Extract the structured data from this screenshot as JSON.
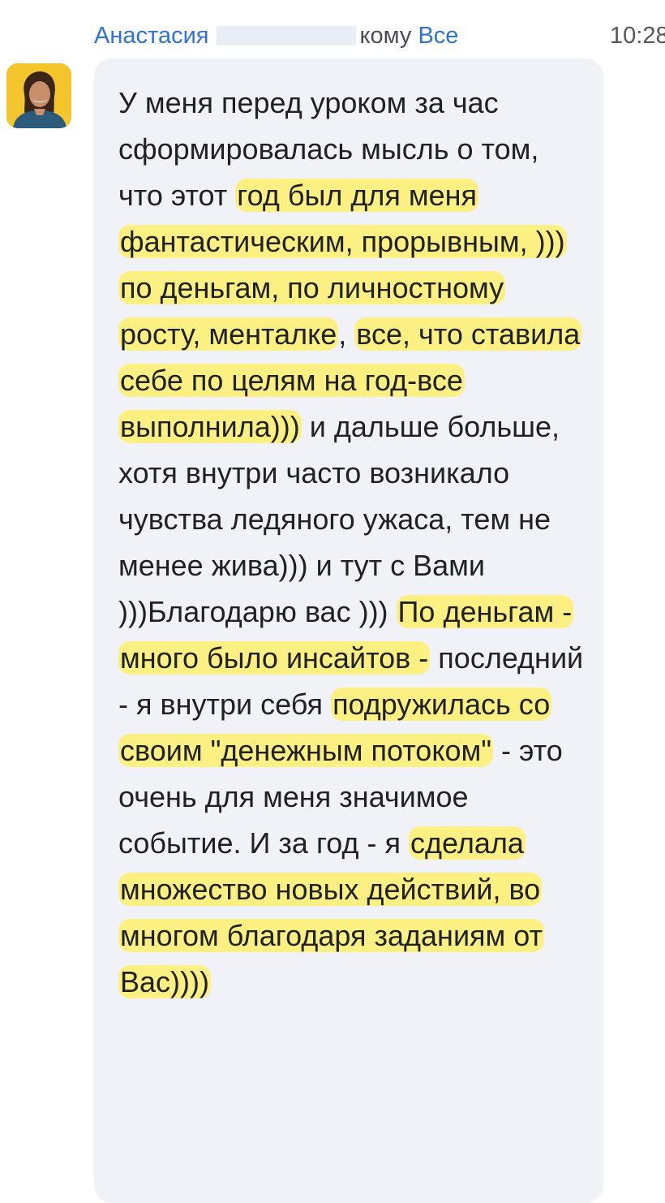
{
  "header": {
    "sender": "Анастасия",
    "to_label": "кому",
    "recipient": "Все",
    "time": "10:28"
  },
  "message": {
    "segments": [
      {
        "text": "У меня перед уроком за час сформировалась мысль о том, что этот ",
        "hl": false
      },
      {
        "text": "год был для меня фантастическим, прорывным, )))",
        "hl": true
      },
      {
        "text": " ",
        "hl": false
      },
      {
        "text": "по деньгам, по личностному росту, менталке",
        "hl": true
      },
      {
        "text": ", ",
        "hl": false
      },
      {
        "text": "все, что ставила себе по целям на год-все выполнила)))",
        "hl": true
      },
      {
        "text": " и дальше больше, хотя внутри часто возникало чувства ледяного ужаса, тем не менее жива))) и тут с Вами )))Благодарю вас )))  ",
        "hl": false
      },
      {
        "text": "По деньгам - много было инсайтов -",
        "hl": true
      },
      {
        "text": " последний - я внутри себя ",
        "hl": false
      },
      {
        "text": "подружилась со своим \"денежным потоком\"",
        "hl": true
      },
      {
        "text": " - это очень для меня значимое событие. И за год - я ",
        "hl": false
      },
      {
        "text": "сделала множество новых действий, во многом благодаря заданиям от Вас))))",
        "hl": true
      }
    ]
  },
  "colors": {
    "accent": "#2f73d6",
    "highlight": "#fdf078",
    "bubble": "#f1f2f8",
    "avatar_bg": "#f4c52d"
  },
  "icons": {
    "avatar": "user-avatar-photo"
  }
}
